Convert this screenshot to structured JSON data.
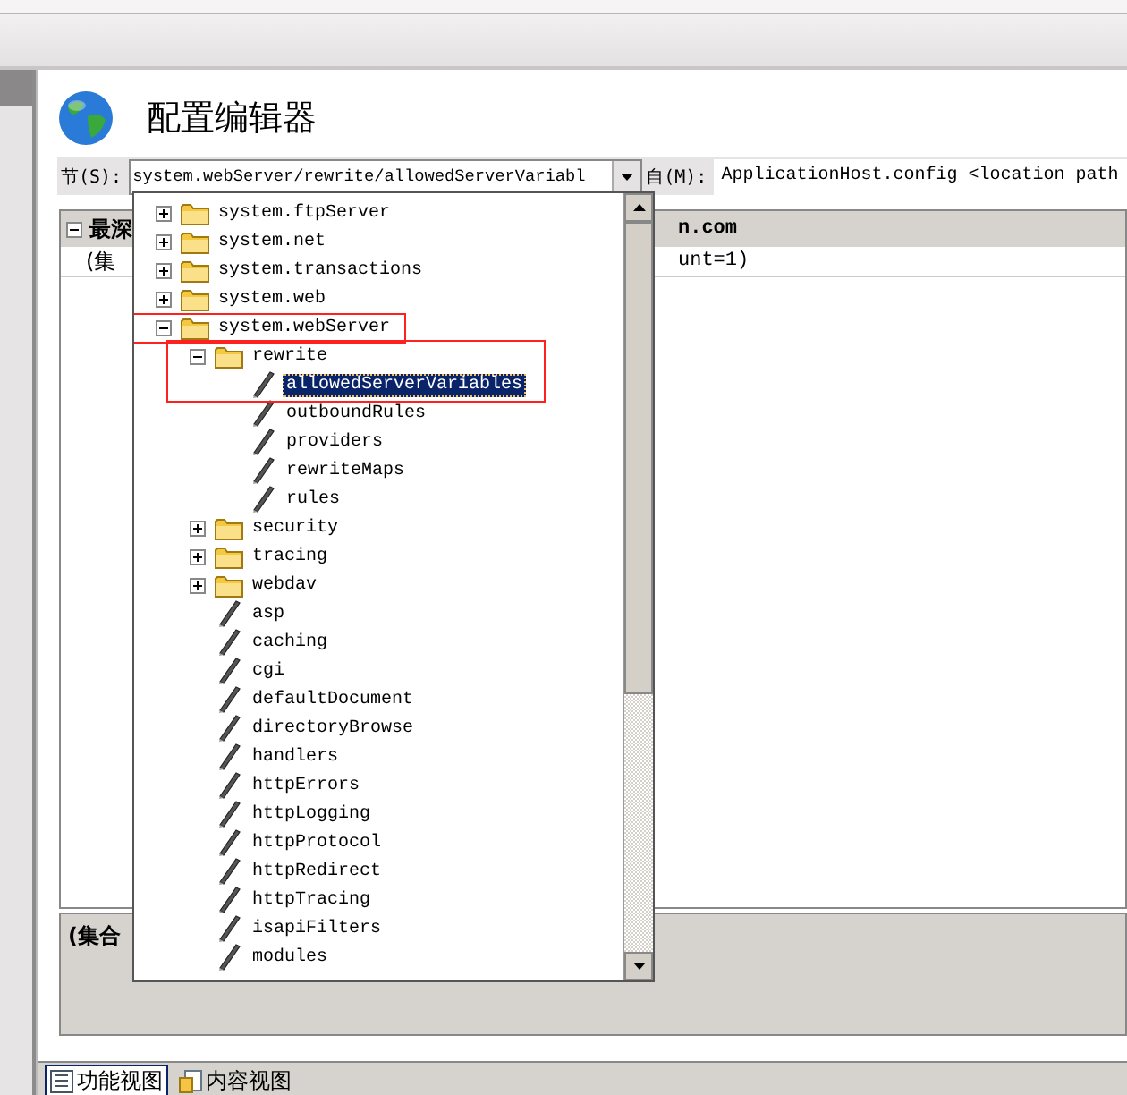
{
  "window": {
    "title": "配置编辑器"
  },
  "section": {
    "label": "节(S):",
    "value": "system.webServer/rewrite/allowedServerVariabl"
  },
  "from": {
    "label": "自(M):",
    "value": "ApplicationHost.config <location path"
  },
  "grid": {
    "header_left": "最深",
    "header_right": "n.com",
    "row_left": "(集",
    "row_right": "unt=1)"
  },
  "details_panel": {
    "text": "(集合"
  },
  "section_dropdown": {
    "items": [
      {
        "label": "system.ftpServer",
        "kind": "folder",
        "expanded": false,
        "selected": false
      },
      {
        "label": "system.net",
        "kind": "folder",
        "expanded": false,
        "selected": false
      },
      {
        "label": "system.transactions",
        "kind": "folder",
        "expanded": false,
        "selected": false
      },
      {
        "label": "system.web",
        "kind": "folder",
        "expanded": false,
        "selected": false
      },
      {
        "label": "system.webServer",
        "kind": "folder",
        "expanded": true,
        "selected": false,
        "children": [
          {
            "label": "rewrite",
            "kind": "folder",
            "expanded": true,
            "selected": false,
            "children": [
              {
                "label": "allowedServerVariables",
                "kind": "leaf",
                "selected": true
              },
              {
                "label": "outboundRules",
                "kind": "leaf",
                "selected": false
              },
              {
                "label": "providers",
                "kind": "leaf",
                "selected": false
              },
              {
                "label": "rewriteMaps",
                "kind": "leaf",
                "selected": false
              },
              {
                "label": "rules",
                "kind": "leaf",
                "selected": false
              }
            ]
          },
          {
            "label": "security",
            "kind": "folder",
            "expanded": false,
            "selected": false
          },
          {
            "label": "tracing",
            "kind": "folder",
            "expanded": false,
            "selected": false
          },
          {
            "label": "webdav",
            "kind": "folder",
            "expanded": false,
            "selected": false
          },
          {
            "label": "asp",
            "kind": "leaf",
            "selected": false
          },
          {
            "label": "caching",
            "kind": "leaf",
            "selected": false
          },
          {
            "label": "cgi",
            "kind": "leaf",
            "selected": false
          },
          {
            "label": "defaultDocument",
            "kind": "leaf",
            "selected": false
          },
          {
            "label": "directoryBrowse",
            "kind": "leaf",
            "selected": false
          },
          {
            "label": "handlers",
            "kind": "leaf",
            "selected": false
          },
          {
            "label": "httpErrors",
            "kind": "leaf",
            "selected": false
          },
          {
            "label": "httpLogging",
            "kind": "leaf",
            "selected": false
          },
          {
            "label": "httpProtocol",
            "kind": "leaf",
            "selected": false
          },
          {
            "label": "httpRedirect",
            "kind": "leaf",
            "selected": false
          },
          {
            "label": "httpTracing",
            "kind": "leaf",
            "selected": false
          },
          {
            "label": "isapiFilters",
            "kind": "leaf",
            "selected": false
          },
          {
            "label": "modules",
            "kind": "leaf",
            "selected": false
          }
        ]
      }
    ]
  },
  "view_tabs": [
    {
      "label": "功能视图",
      "selected": true
    },
    {
      "label": "内容视图",
      "selected": false
    }
  ]
}
